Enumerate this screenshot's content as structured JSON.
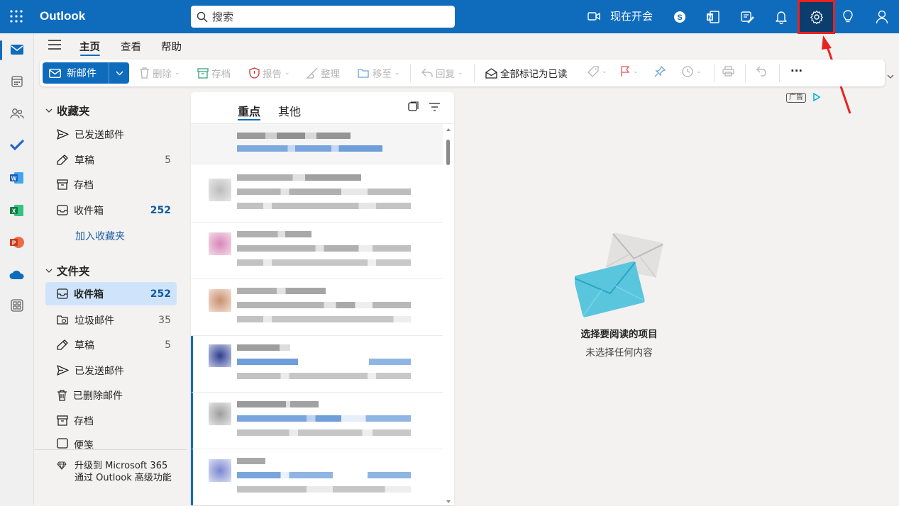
{
  "app": {
    "name": "Outlook"
  },
  "search": {
    "placeholder": "搜索"
  },
  "topbar": {
    "meet_now": "现在开会",
    "icons": [
      "video-icon",
      "skype-icon",
      "onenote-icon",
      "feedback-icon",
      "bell-icon",
      "gear-icon",
      "lightbulb-icon",
      "person-icon"
    ]
  },
  "ribbon_tabs": [
    {
      "label": "主页",
      "active": true
    },
    {
      "label": "查看"
    },
    {
      "label": "帮助"
    }
  ],
  "ribbon": {
    "new_mail": "新邮件",
    "delete": "删除",
    "archive": "存档",
    "report": "报告",
    "sweep": "整理",
    "move_to": "移至",
    "reply": "回复",
    "mark_all_read": "全部标记为已读",
    "more": "···"
  },
  "favorites": {
    "title": "收藏夹",
    "items": [
      {
        "label": "已发送邮件",
        "icon": "send-icon",
        "count": ""
      },
      {
        "label": "草稿",
        "icon": "pencil-icon",
        "count": "5"
      },
      {
        "label": "存档",
        "icon": "archive-icon",
        "count": ""
      },
      {
        "label": "收件箱",
        "icon": "inbox-icon",
        "count": "252"
      }
    ],
    "add": "加入收藏夹"
  },
  "folders": {
    "title": "文件夹",
    "items": [
      {
        "label": "收件箱",
        "icon": "inbox-icon",
        "count": "252"
      },
      {
        "label": "垃圾邮件",
        "icon": "junk-icon",
        "count": "35"
      },
      {
        "label": "草稿",
        "icon": "pencil-icon",
        "count": "5"
      },
      {
        "label": "已发送邮件",
        "icon": "send-icon",
        "count": ""
      },
      {
        "label": "已删除邮件",
        "icon": "trash-icon",
        "count": ""
      },
      {
        "label": "存档",
        "icon": "archive-icon",
        "count": ""
      },
      {
        "label": "便笺",
        "icon": "note-icon",
        "count": ""
      }
    ]
  },
  "upgrade": {
    "text": "升级到 Microsoft 365 通过 Outlook 高级功能"
  },
  "mail_list": {
    "tabs": [
      {
        "label": "重点",
        "active": true
      },
      {
        "label": "其他"
      }
    ]
  },
  "reading_pane": {
    "ad_label": "广告",
    "empty_title": "选择要阅读的项目",
    "empty_subtitle": "未选择任何内容"
  },
  "colors": {
    "brand": "#0f6cbd",
    "highlight": "#e8231f",
    "selected_folder": "#cfe4fa"
  }
}
